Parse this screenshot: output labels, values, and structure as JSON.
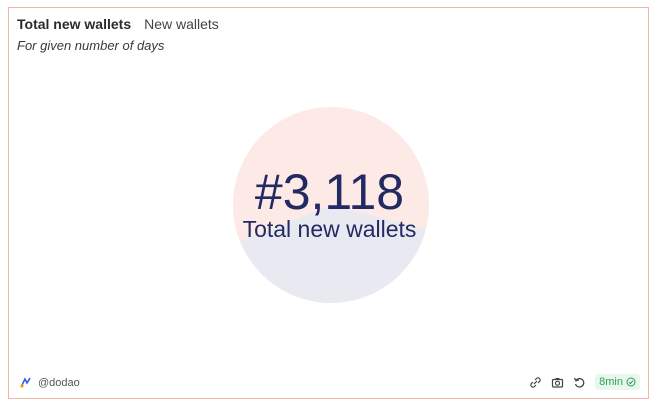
{
  "widget": {
    "title": "Total new wallets",
    "tab_label": "New wallets",
    "subtitle": "For given number of days",
    "value": "#3,118",
    "value_label": "Total new wallets"
  },
  "chart_data": {
    "type": "pie",
    "categories": [
      "",
      ""
    ],
    "values": [
      60,
      40
    ],
    "colors": [
      "#fde9e5",
      "#e9e9f1"
    ],
    "title": "",
    "legend": "none"
  },
  "footer": {
    "author": "@dodao",
    "refresh_badge": "8min"
  },
  "icons": {
    "author": "dodao-logo-icon",
    "embed": "embed-link-icon",
    "screenshot": "camera-icon",
    "refresh": "refresh-icon",
    "status": "check-circle-icon"
  },
  "colors": {
    "border": "#f0b4a8",
    "value_text": "#232a63",
    "badge_green": "#2f9e5a"
  }
}
